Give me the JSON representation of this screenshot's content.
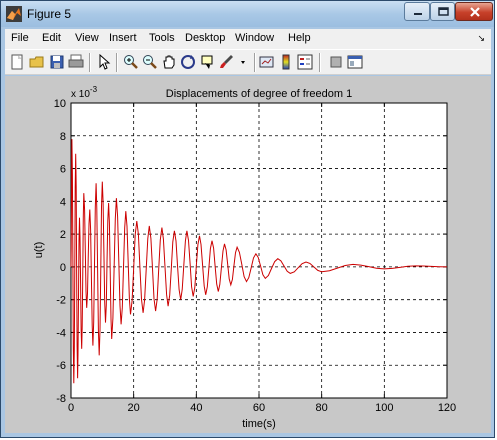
{
  "window": {
    "title": "Figure 5",
    "minimize": "minimize",
    "maximize": "maximize",
    "close": "close"
  },
  "menu": [
    "File",
    "Edit",
    "View",
    "Insert",
    "Tools",
    "Desktop",
    "Window",
    "Help"
  ],
  "toolbar": [
    "new-figure-icon",
    "open-file-icon",
    "save-icon",
    "print-icon",
    "edit-plot-icon",
    "zoom-in-icon",
    "zoom-out-icon",
    "pan-icon",
    "rotate-3d-icon",
    "data-cursor-icon",
    "brush-icon",
    "brush-dropdown-icon",
    "link-plot-icon",
    "colorbar-icon",
    "legend-icon",
    "hide-plot-tools-icon",
    "show-plot-tools-icon"
  ],
  "chart_data": {
    "type": "line",
    "title": "Displacements of degree of freedom 1",
    "xlabel": "time(s)",
    "ylabel": "u(t)",
    "y_exponent": "x 10",
    "y_exponent_power": "-3",
    "xlim": [
      0,
      120
    ],
    "ylim": [
      -8,
      10
    ],
    "xticks": [
      0,
      20,
      40,
      60,
      80,
      100,
      120
    ],
    "yticks": [
      -8,
      -6,
      -4,
      -2,
      0,
      2,
      4,
      6,
      8,
      10
    ],
    "grid": true,
    "line_color": "#cc0000",
    "series": [
      {
        "envelope_note_free": true,
        "x": [
          0.3,
          0.9,
          1.5,
          2.1,
          2.7,
          3.4,
          4.1,
          5.0,
          6.0,
          7.0,
          8.0,
          9.0,
          10.0,
          11.0,
          12.0,
          13.0,
          14.5,
          16.0,
          17.5,
          19.0,
          21.0,
          23.0,
          25.0,
          27.0,
          29.0,
          31.0,
          33.0,
          35.0,
          37.0,
          39.0,
          41.0,
          43.0,
          45.0,
          47.0,
          49.0,
          51.0,
          53.0,
          56.0,
          59.0,
          62.0,
          66.0,
          70.0,
          75.0,
          80.0,
          90.0,
          100.0,
          110.0,
          120.0
        ],
        "y": [
          7.8,
          -7.1,
          6.9,
          -6.8,
          3.0,
          -5.0,
          4.5,
          -2.5,
          3.5,
          -4.8,
          5.1,
          -5.4,
          5.2,
          -3.4,
          3.9,
          -4.4,
          4.2,
          -3.5,
          3.4,
          -2.9,
          2.8,
          -2.8,
          2.5,
          -2.7,
          2.4,
          -2.4,
          2.2,
          -2.0,
          2.2,
          -1.8,
          1.9,
          -1.7,
          1.6,
          -1.5,
          1.4,
          -1.1,
          1.2,
          -0.9,
          0.8,
          -0.7,
          0.5,
          -0.4,
          0.3,
          -0.3,
          0.15,
          -0.12,
          0.06,
          0.0
        ]
      }
    ]
  }
}
